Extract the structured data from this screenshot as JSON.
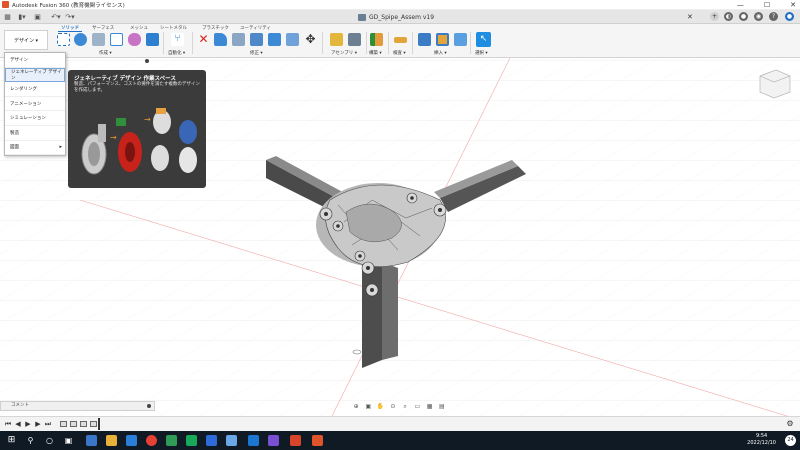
{
  "window": {
    "title": "Autodesk Fusion 360 (教育機関ライセンス)",
    "min": "—",
    "max": "☐",
    "close": "✕"
  },
  "document": {
    "tab_title": "GD_Spipe_Assem v19"
  },
  "ribbon": {
    "workspace_button": "デザイン ▾",
    "tabs": [
      "ソリッド",
      "サーフェス",
      "メッシュ",
      "シートメタル",
      "プラスチック",
      "ユーティリティ"
    ],
    "groups": [
      "作成 ▾",
      "自動化 ▾",
      "修正 ▾",
      "アセンブリ ▾",
      "構築 ▾",
      "検査 ▾",
      "挿入 ▾",
      "選択 ▾"
    ]
  },
  "workspace_menu": {
    "items": [
      "デザイン",
      "ジェネレーティブ デザイン",
      "レンダリング",
      "アニメーション",
      "シミュレーション",
      "製造",
      "図面"
    ]
  },
  "tooltip": {
    "title": "ジェネレーティブ デザイン 作業スペース",
    "text": "製造、パフォーマンス、コストの要件を満たす複数のデザインを作成します。"
  },
  "comments": {
    "label": "コメント"
  },
  "statusbar": {
    "time": "9:54",
    "date": "2022/12/10",
    "notifications": "24"
  },
  "colors": {
    "accent": "#1f6fc6",
    "active_blue": "#1f6fc6",
    "model_gray": "#5d5d5d",
    "taskbar": "#101a24"
  },
  "icons": [
    "grid-icon",
    "file-icon",
    "save-icon",
    "undo-icon",
    "redo-icon",
    "close-icon",
    "add-tab-icon",
    "job-status-icon",
    "notification-icon",
    "help-icon",
    "profile-icon",
    "orbit-icon",
    "pan-icon",
    "zoom-icon",
    "fit-icon",
    "display-settings-icon",
    "grid-settings-icon",
    "viewports-icon",
    "viewcube-icon",
    "play-icon",
    "step-back-icon",
    "step-forward-icon",
    "rewind-icon",
    "end-icon",
    "settings-icon",
    "windows-start-icon",
    "search-icon",
    "task-view-icon"
  ]
}
